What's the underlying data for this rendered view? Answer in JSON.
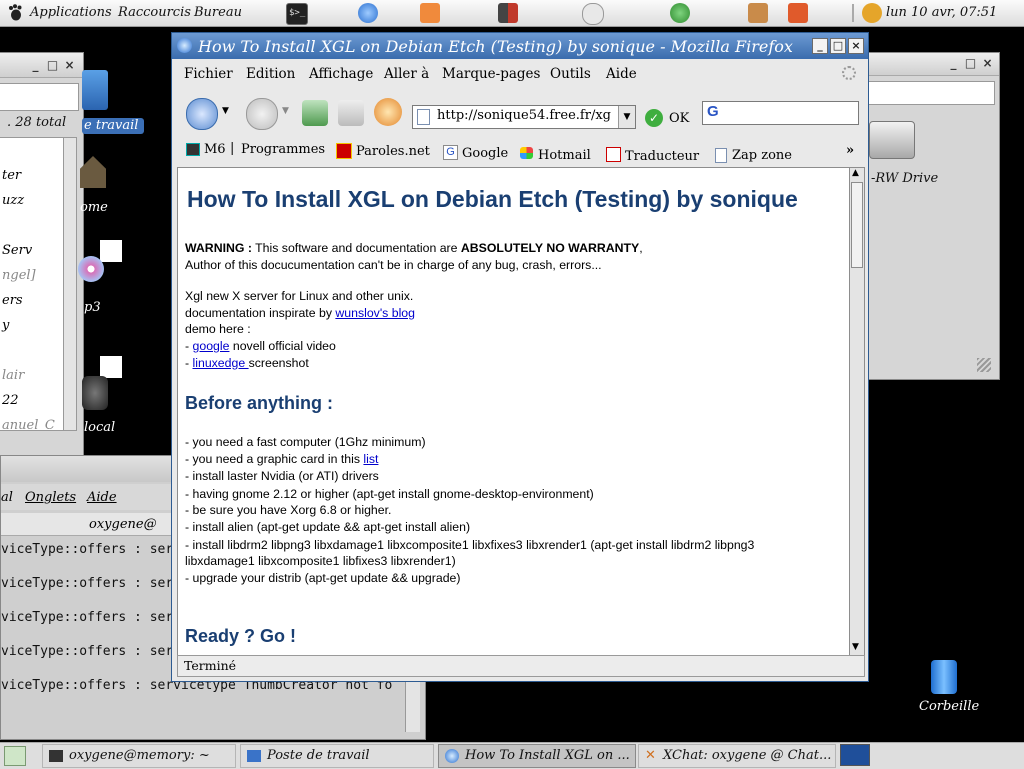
{
  "top_panel": {
    "menus": [
      "Applications",
      "Raccourcis",
      "Bureau"
    ],
    "clock": "lun 10 avr, 07:51"
  },
  "desktop": {
    "icons": {
      "poste_travail": "e travail",
      "home": "ome",
      "mp3": "p3",
      "local": "local",
      "rw_drive": "-RW Drive",
      "trash": "Corbeille"
    },
    "left_window": {
      "status": ". 28 total",
      "items": [
        "ter",
        "uzz",
        "Serv",
        "ngel]",
        "ers",
        "y",
        "lair",
        "22",
        "anuel_C"
      ]
    }
  },
  "terminal": {
    "menu": [
      "al",
      "Onglets",
      "Aide"
    ],
    "tab_title": "oxygene@",
    "lines": [
      "viceType::offers : ser",
      "viceType::offers : ser",
      "viceType::offers : ser",
      "viceType::offers : ser",
      "viceType::offers : servicetype ThumbCreator not fo"
    ]
  },
  "firefox": {
    "title": "How To Install XGL on Debian Etch (Testing) by sonique - Mozilla Firefox",
    "menu": [
      "Fichier",
      "Edition",
      "Affichage",
      "Aller à",
      "Marque-pages",
      "Outils",
      "Aide"
    ],
    "url": "http://sonique54.free.fr/xg",
    "ok_label": "OK",
    "search_value": "G",
    "bookmarks": [
      "M6",
      "Programmes",
      "Paroles.net",
      "Google",
      "Hotmail",
      "Traducteur",
      "Zap zone"
    ],
    "more_bookmarks": "»",
    "status": "Terminé",
    "page": {
      "heading": "How To Install XGL on Debian Etch (Testing) by sonique",
      "warning_label": "WARNING :",
      "warning_text_1": " This software and documentation are ",
      "warning_strong": "ABSOLUTELY NO WARRANTY",
      "warning_text_2": ",",
      "author_line": "Author of this docucumentation can't be in charge of any bug, crash, errors...",
      "intro_1": "Xgl new X server for Linux and other unix.",
      "intro_2_text": "documentation inspirate by ",
      "intro_2_link": "wunslov's blog",
      "intro_3": "demo here :",
      "demo_1_prefix": "- ",
      "demo_1_link": "google",
      "demo_1_suffix": " novell official video",
      "demo_2_prefix": "- ",
      "demo_2_link": "linuxedge ",
      "demo_2_suffix": "screenshot",
      "section_1": "Before anything :",
      "req_1": "- you need a fast computer (1Ghz minimum)",
      "req_2_text": "- you need a graphic card in this ",
      "req_2_link": "list",
      "req_3": "- install laster Nvidia (or ATI) drivers",
      "req_4": "- having gnome 2.12 or higher (apt-get install gnome-desktop-environment)",
      "req_5": "- be sure you have Xorg 6.8 or higher.",
      "req_6": "- install alien (apt-get update && apt-get install alien)",
      "req_7": "- install libdrm2 libpng3 libxdamage1 libxcomposite1 libxfixes3 libxrender1 (apt-get install libdrm2 libpng3",
      "req_7b": "libxdamage1 libxcomposite1 libfixes3 libxrender1)",
      "req_8": "- upgrade your distrib (apt-get update && upgrade)",
      "section_2": "Ready ? Go !"
    }
  },
  "taskbar": {
    "items": [
      "oxygene@memory: ~",
      "Poste de travail",
      "How To Install XGL on ...",
      "XChat: oxygene @ Chat..."
    ]
  },
  "colors": {
    "firefox_title": "#3a6cad",
    "heading": "#1a3f72",
    "link": "#0000cc"
  }
}
